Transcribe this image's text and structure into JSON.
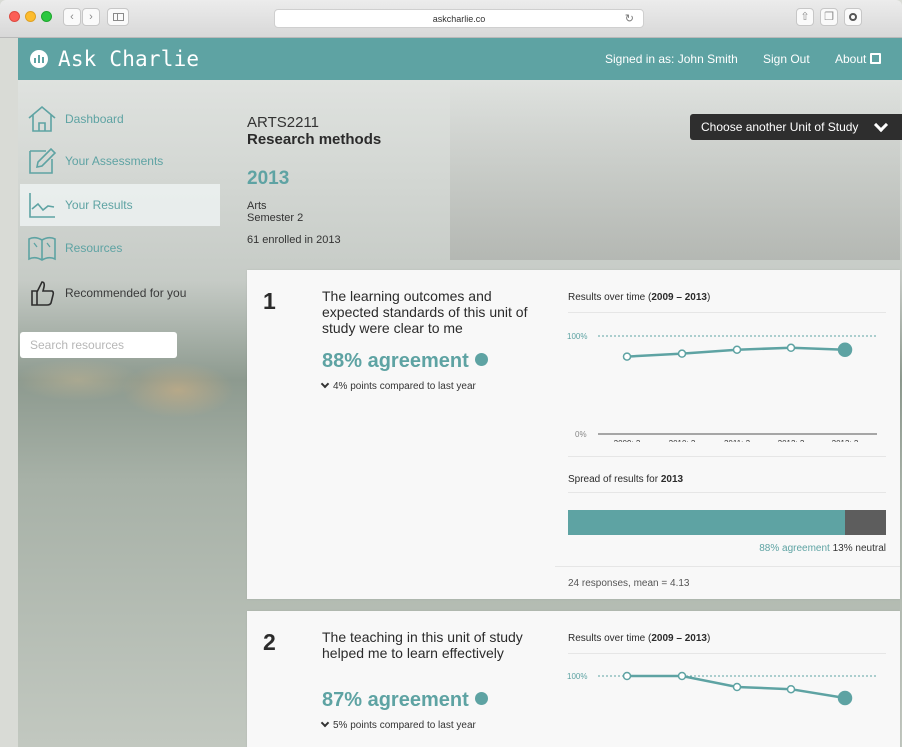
{
  "browser": {
    "url": "askcharlie.co"
  },
  "header": {
    "app_name": "Ask Charlie",
    "signed_in": "Signed in as: John Smith",
    "sign_out": "Sign Out",
    "about": "About"
  },
  "sidebar": {
    "items": [
      {
        "label": "Dashboard",
        "icon": "house-icon"
      },
      {
        "label": "Your Assessments",
        "icon": "pencil-icon"
      },
      {
        "label": "Your Results",
        "icon": "line-chart-icon",
        "active": true
      },
      {
        "label": "Resources",
        "icon": "book-icon"
      },
      {
        "label": "Recommended for you",
        "icon": "thumbs-up-icon"
      }
    ],
    "search_placeholder": "Search resources"
  },
  "unit": {
    "code": "ARTS2211",
    "name": "Research methods",
    "year": "2013",
    "faculty": "Arts",
    "semester": "Semester 2",
    "enrolled": "61 enrolled in 2013",
    "choose_label": "Choose another Unit of Study"
  },
  "colors": {
    "accent": "#5ea3a3",
    "dark": "#2e2e2e",
    "neutral_bar": "#5d5d5d"
  },
  "questions": [
    {
      "number": "1",
      "text": "The learning outcomes and expected standards of this unit of study were clear to me",
      "agreement": "88% agreement",
      "comparison": "4% points compared to last year",
      "chart_title_prefix": "Results over time (",
      "chart_title_range": "2009 – 2013",
      "chart_title_suffix": ")",
      "spread_prefix": "Spread of results for ",
      "spread_year": "2013",
      "spread_agree_label": "88% agreement",
      "spread_neutral_label": "13% neutral",
      "spread_agree_fraction": 0.87,
      "footer": "24 responses, mean = 4.13"
    },
    {
      "number": "2",
      "text": "The teaching in this unit of study helped me to learn effectively",
      "agreement": "87% agreement",
      "comparison": "5% points compared to last year",
      "chart_title_prefix": "Results over time (",
      "chart_title_range": "2009 – 2013",
      "chart_title_suffix": ")"
    }
  ],
  "chart_data": [
    {
      "type": "line",
      "title": "Results over time (2009 – 2013)",
      "categories": [
        "2009: 2",
        "2010: 2",
        "2011: 2",
        "2012: 2",
        "2013: 2"
      ],
      "values": [
        79,
        82,
        86,
        88,
        86
      ],
      "y_tick_labels": [
        "0%",
        "100%"
      ],
      "ylim": [
        0,
        100
      ],
      "reference_line": 100
    },
    {
      "type": "line",
      "title": "Results over time (2009 – 2013)",
      "y_tick_labels": [
        "100%"
      ],
      "values": [
        100,
        100,
        95,
        94,
        90
      ],
      "ylim": [
        0,
        100
      ],
      "reference_line": 100
    }
  ]
}
